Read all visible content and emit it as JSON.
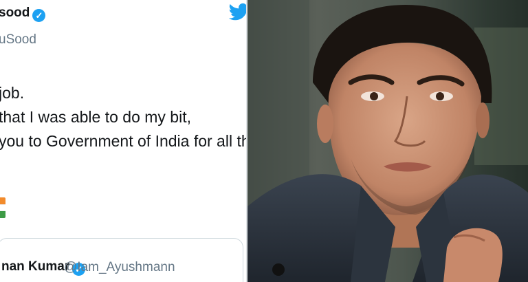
{
  "tweet": {
    "author_name": "sood",
    "author_handle": "uSood",
    "lines": [
      "job.",
      "that I was able to do my bit,",
      "you to Government of India for all the"
    ],
    "flag_icon": "india-flag-emoji",
    "quoted": {
      "name": "nan Kumar",
      "handle": "@Iam_Ayushmann"
    }
  },
  "colors": {
    "twitter_blue": "#1da1f2",
    "text": "#14171a",
    "muted": "#657786"
  },
  "photo": {
    "subject": "man-in-dark-coat-portrait"
  }
}
